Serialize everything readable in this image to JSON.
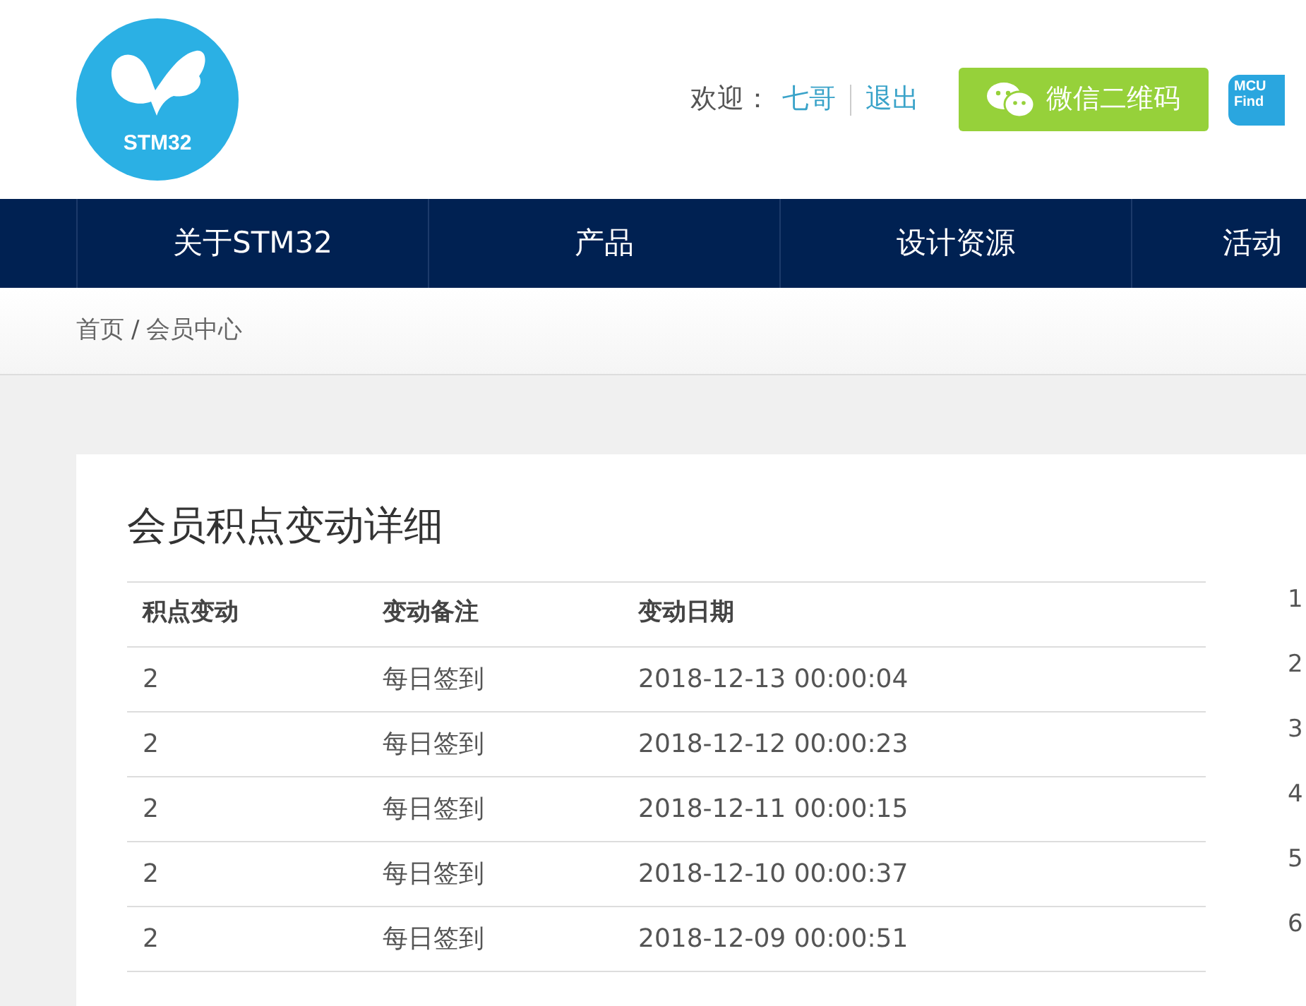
{
  "header": {
    "logo_text": "STM32",
    "welcome_label": "欢迎：",
    "user_link": "七哥",
    "logout_link": "退出",
    "wechat_button": "微信二维码",
    "badge_lines": [
      "MCU",
      "Find"
    ]
  },
  "nav": [
    {
      "label": "关于STM32"
    },
    {
      "label": "产品"
    },
    {
      "label": "设计资源"
    },
    {
      "label": "活动"
    }
  ],
  "breadcrumb": {
    "items": [
      "首页",
      "会员中心"
    ],
    "separator": "/"
  },
  "points_panel": {
    "title": "会员积点变动详细",
    "columns": [
      "积点变动",
      "变动备注",
      "变动日期"
    ],
    "rows": [
      {
        "points": "2",
        "note": "每日签到",
        "date": "2018-12-13 00:00:04"
      },
      {
        "points": "2",
        "note": "每日签到",
        "date": "2018-12-12 00:00:23"
      },
      {
        "points": "2",
        "note": "每日签到",
        "date": "2018-12-11 00:00:15"
      },
      {
        "points": "2",
        "note": "每日签到",
        "date": "2018-12-10 00:00:37"
      },
      {
        "points": "2",
        "note": "每日签到",
        "date": "2018-12-09 00:00:51"
      }
    ]
  },
  "side_table": {
    "rows": [
      "1",
      "2",
      "3",
      "4",
      "5",
      "6"
    ]
  }
}
